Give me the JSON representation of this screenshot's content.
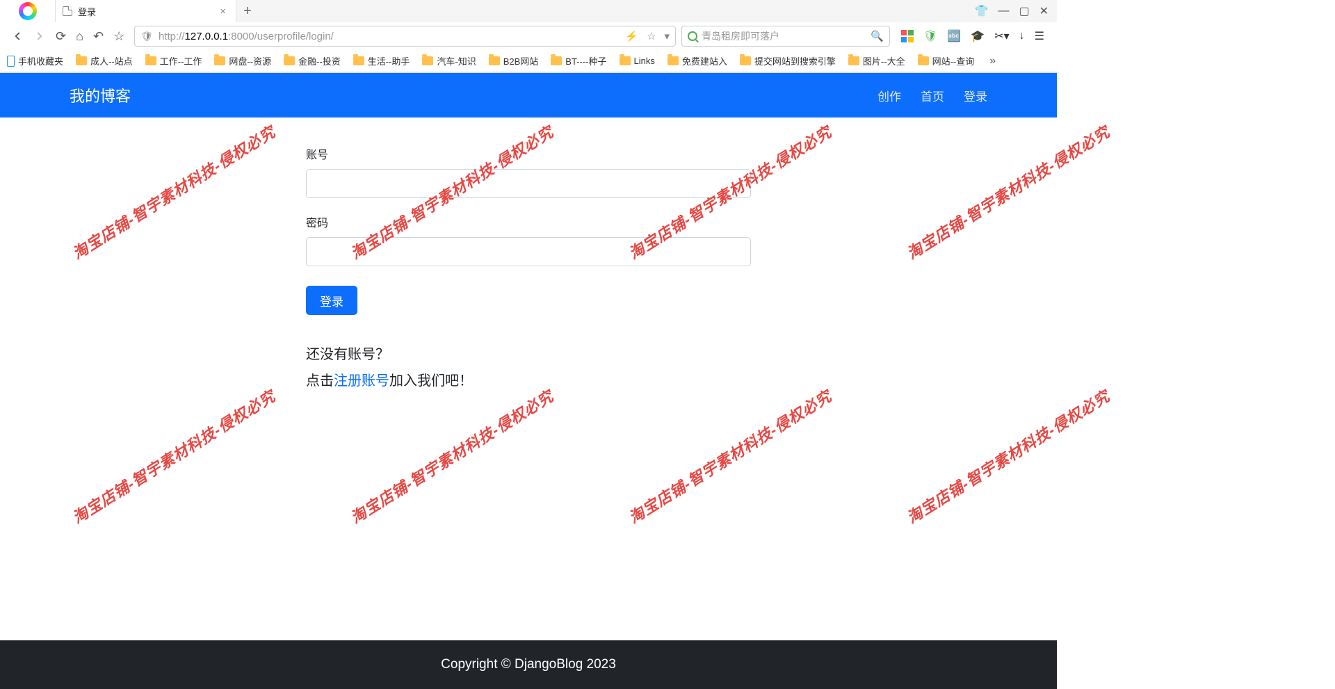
{
  "browser": {
    "tab_title": "登录",
    "url_protocol": "http://",
    "url_host": "127.0.0.1",
    "url_port": ":8000",
    "url_path": "/userprofile/login/",
    "search_placeholder": "青岛租房即可落户"
  },
  "bookmarks": [
    {
      "label": "手机收藏夹",
      "type": "phone"
    },
    {
      "label": "成人--站点",
      "type": "folder"
    },
    {
      "label": "工作--工作",
      "type": "folder"
    },
    {
      "label": "网盘--资源",
      "type": "folder"
    },
    {
      "label": "金融--投资",
      "type": "folder"
    },
    {
      "label": "生活--助手",
      "type": "folder"
    },
    {
      "label": "汽车-知识",
      "type": "folder"
    },
    {
      "label": "B2B网站",
      "type": "folder"
    },
    {
      "label": "BT----种子",
      "type": "folder"
    },
    {
      "label": "Links",
      "type": "folder"
    },
    {
      "label": "免费建站入",
      "type": "folder"
    },
    {
      "label": "提交网站到搜索引擎",
      "type": "folder"
    },
    {
      "label": "图片--大全",
      "type": "folder"
    },
    {
      "label": "网站--查询",
      "type": "folder"
    }
  ],
  "site": {
    "brand": "我的博客",
    "nav": {
      "create": "创作",
      "home": "首页",
      "login": "登录"
    }
  },
  "form": {
    "username_label": "账号",
    "password_label": "密码",
    "login_button": "登录",
    "no_account_q": "还没有账号？",
    "click_prefix": "点击",
    "register_link": "注册账号",
    "click_suffix": "加入我们吧！"
  },
  "footer": {
    "text": "Copyright © DjangoBlog 2023"
  },
  "watermark_text": "淘宝店铺-智宇素材科技-侵权必究"
}
